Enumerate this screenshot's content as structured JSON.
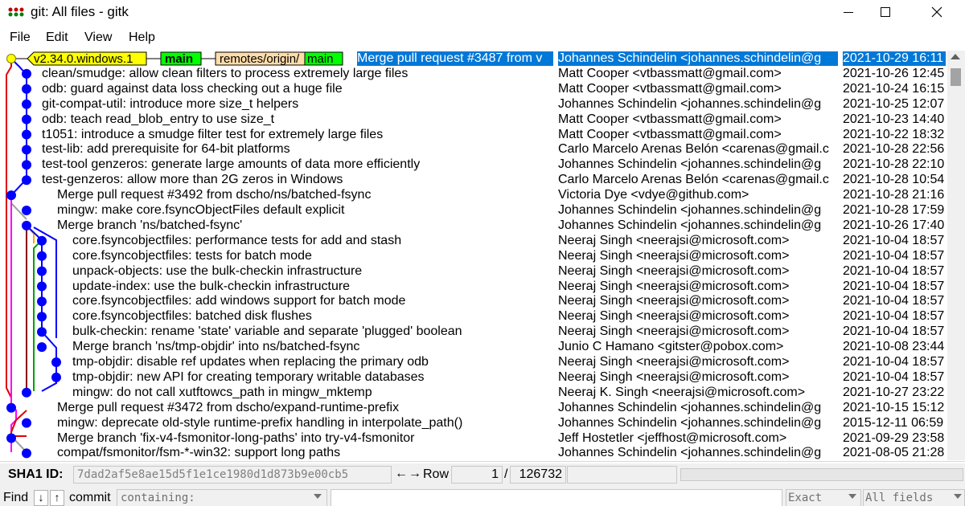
{
  "window": {
    "title": "git: All files - gitk"
  },
  "menu": [
    "File",
    "Edit",
    "View",
    "Help"
  ],
  "refs": {
    "tag": "v2.34.0.windows.1",
    "head": "main",
    "remote_prefix": "remotes/origin/",
    "remote_branch": "main"
  },
  "commits": [
    {
      "subject": "Merge pull request #3487 from v",
      "author": "Johannes Schindelin <johannes.schindelin@g",
      "date": "2021-10-29 16:11",
      "selected": true
    },
    {
      "subject": "clean/smudge: allow clean filters to process extremely large files",
      "author": "Matt Cooper <vtbassmatt@gmail.com>",
      "date": "2021-10-26 12:45"
    },
    {
      "subject": "odb: guard against data loss checking out a huge file",
      "author": "Matt Cooper <vtbassmatt@gmail.com>",
      "date": "2021-10-24 16:15"
    },
    {
      "subject": "git-compat-util: introduce more size_t helpers",
      "author": "Johannes Schindelin <johannes.schindelin@g",
      "date": "2021-10-25 12:07"
    },
    {
      "subject": "odb: teach read_blob_entry to use size_t",
      "author": "Matt Cooper <vtbassmatt@gmail.com>",
      "date": "2021-10-23 14:40"
    },
    {
      "subject": "t1051: introduce a smudge filter test for extremely large files",
      "author": "Matt Cooper <vtbassmatt@gmail.com>",
      "date": "2021-10-22 18:32"
    },
    {
      "subject": "test-lib: add prerequisite for 64-bit platforms",
      "author": "Carlo Marcelo Arenas Belón <carenas@gmail.c",
      "date": "2021-10-28 22:56"
    },
    {
      "subject": "test-tool genzeros: generate large amounts of data more efficiently",
      "author": "Johannes Schindelin <johannes.schindelin@g",
      "date": "2021-10-28 22:10"
    },
    {
      "subject": "test-genzeros: allow more than 2G zeros in Windows",
      "author": "Carlo Marcelo Arenas Belón <carenas@gmail.c",
      "date": "2021-10-28 10:54"
    },
    {
      "subject": "Merge pull request #3492 from dscho/ns/batched-fsync",
      "author": "Victoria Dye <vdye@github.com>",
      "date": "2021-10-28 21:16"
    },
    {
      "subject": "mingw: make core.fsyncObjectFiles default explicit",
      "author": "Johannes Schindelin <johannes.schindelin@g",
      "date": "2021-10-28 17:59"
    },
    {
      "subject": "Merge branch 'ns/batched-fsync'",
      "author": "Johannes Schindelin <johannes.schindelin@g",
      "date": "2021-10-26 17:40"
    },
    {
      "subject": "core.fsyncobjectfiles: performance tests for add and stash",
      "author": "Neeraj Singh <neerajsi@microsoft.com>",
      "date": "2021-10-04 18:57"
    },
    {
      "subject": "core.fsyncobjectfiles: tests for batch mode",
      "author": "Neeraj Singh <neerajsi@microsoft.com>",
      "date": "2021-10-04 18:57"
    },
    {
      "subject": "unpack-objects: use the bulk-checkin infrastructure",
      "author": "Neeraj Singh <neerajsi@microsoft.com>",
      "date": "2021-10-04 18:57"
    },
    {
      "subject": "update-index: use the bulk-checkin infrastructure",
      "author": "Neeraj Singh <neerajsi@microsoft.com>",
      "date": "2021-10-04 18:57"
    },
    {
      "subject": "core.fsyncobjectfiles: add windows support for batch mode",
      "author": "Neeraj Singh <neerajsi@microsoft.com>",
      "date": "2021-10-04 18:57"
    },
    {
      "subject": "core.fsyncobjectfiles: batched disk flushes",
      "author": "Neeraj Singh <neerajsi@microsoft.com>",
      "date": "2021-10-04 18:57"
    },
    {
      "subject": "bulk-checkin: rename 'state' variable and separate 'plugged' boolean",
      "author": "Neeraj Singh <neerajsi@microsoft.com>",
      "date": "2021-10-04 18:57"
    },
    {
      "subject": "Merge branch 'ns/tmp-objdir' into ns/batched-fsync",
      "author": "Junio C Hamano <gitster@pobox.com>",
      "date": "2021-10-08 23:44"
    },
    {
      "subject": "tmp-objdir: disable ref updates when replacing the primary odb",
      "author": "Neeraj Singh <neerajsi@microsoft.com>",
      "date": "2021-10-04 18:57"
    },
    {
      "subject": "tmp-objdir: new API for creating temporary writable databases",
      "author": "Neeraj Singh <neerajsi@microsoft.com>",
      "date": "2021-10-04 18:57"
    },
    {
      "subject": "mingw: do not call xutftowcs_path in mingw_mktemp",
      "author": "Neeraj K. Singh <neerajsi@microsoft.com>",
      "date": "2021-10-27 23:22"
    },
    {
      "subject": "Merge pull request #3472 from dscho/expand-runtime-prefix",
      "author": "Johannes Schindelin <johannes.schindelin@g",
      "date": "2021-10-15 15:12"
    },
    {
      "subject": "mingw: deprecate old-style runtime-prefix handling in interpolate_path()",
      "author": "Johannes Schindelin <johannes.schindelin@g",
      "date": "2015-12-11 06:59"
    },
    {
      "subject": "Merge branch 'fix-v4-fsmonitor-long-paths' into try-v4-fsmonitor",
      "author": "Jeff Hostetler <jeffhost@microsoft.com>",
      "date": "2021-09-29 23:58"
    },
    {
      "subject": "compat/fsmonitor/fsm-*-win32: support long paths",
      "author": "Johannes Schindelin <johannes.schindelin@g",
      "date": "2021-08-05 21:28"
    }
  ],
  "sha": {
    "label": "SHA1 ID:",
    "value": "7dad2af5e8ae15d5f1e1ce1980d1d873b9e00cb5"
  },
  "row": {
    "label": "Row",
    "current": "1",
    "slash": "/",
    "total": "126732"
  },
  "find": {
    "label": "Find",
    "down": "↓",
    "up": "↑",
    "type": "commit",
    "mode": "containing:",
    "match": "Exact",
    "fields": "All fields"
  },
  "nav": {
    "back": "←",
    "forward": "→"
  },
  "colors": {
    "selection": "#0078d7",
    "tag": "#ffff00",
    "head": "#00ff00",
    "remote": "#ffddaa",
    "node": "#0000ff"
  }
}
